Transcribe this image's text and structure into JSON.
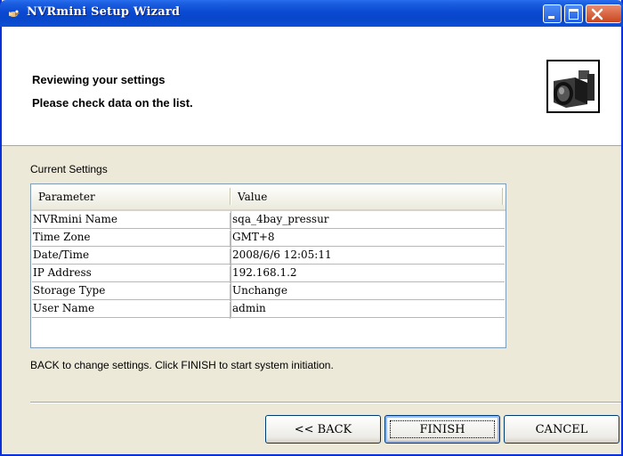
{
  "window": {
    "title": "NVRmini Setup Wizard"
  },
  "header": {
    "title": "Reviewing your settings",
    "subtitle": "Please check data on the list."
  },
  "settings": {
    "label": "Current Settings",
    "columns": [
      "Parameter",
      "Value"
    ],
    "rows": [
      [
        "NVRmini Name",
        "sqa_4bay_pressur"
      ],
      [
        "Time Zone",
        "GMT+8"
      ],
      [
        "Date/Time",
        "2008/6/6 12:05:11"
      ],
      [
        "IP Address",
        "192.168.1.2"
      ],
      [
        "Storage Type",
        "Unchange"
      ],
      [
        "User Name",
        "admin"
      ]
    ]
  },
  "info_text": "BACK to change settings. Click FINISH to start system initiation.",
  "buttons": {
    "back": "<< BACK",
    "finish": "FINISH",
    "cancel": "CANCEL"
  },
  "colors": {
    "titlebar": "#0a49d3",
    "close_button": "#c9461f",
    "dialog_bg": "#ece9d8"
  },
  "icons": {
    "title": "wizard-app-icon",
    "header": "camera-icon"
  }
}
